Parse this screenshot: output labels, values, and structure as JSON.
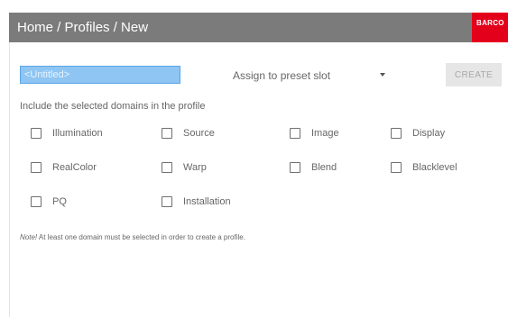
{
  "header": {
    "breadcrumb": "Home / Profiles / New",
    "logo_text": "BARCO",
    "logo_color": "#e3001b",
    "bar_color": "#7b7b7b"
  },
  "form": {
    "name_placeholder": "<Untitled>",
    "preset_label": "Assign to preset slot",
    "create_label": "CREATE",
    "domains_heading": "Include the selected domains in the profile"
  },
  "domains": [
    {
      "label": "Illumination",
      "checked": false
    },
    {
      "label": "Source",
      "checked": false
    },
    {
      "label": "Image",
      "checked": false
    },
    {
      "label": "Display",
      "checked": false
    },
    {
      "label": "RealColor",
      "checked": false
    },
    {
      "label": "Warp",
      "checked": false
    },
    {
      "label": "Blend",
      "checked": false
    },
    {
      "label": "Blacklevel",
      "checked": false
    },
    {
      "label": "PQ",
      "checked": false
    },
    {
      "label": "Installation",
      "checked": false
    }
  ],
  "note": {
    "prefix": "Note!",
    "text": " At least one domain must be selected in order to create a profile."
  },
  "colors": {
    "input_fill": "#8ec5f3",
    "create_bg": "#e6e6e6"
  }
}
